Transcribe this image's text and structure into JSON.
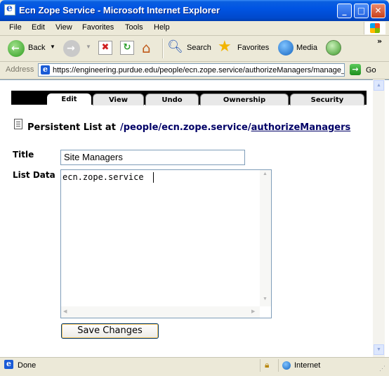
{
  "window": {
    "title": "Ecn Zope Service - Microsoft Internet Explorer"
  },
  "menu": [
    "File",
    "Edit",
    "View",
    "Favorites",
    "Tools",
    "Help"
  ],
  "toolbar": {
    "back": "Back",
    "search": "Search",
    "favorites": "Favorites",
    "media": "Media"
  },
  "address": {
    "label": "Address",
    "url": "https://engineering.purdue.edu/people/ecn.zope.service/authorizeManagers/manage_main",
    "go": "Go"
  },
  "tabs": [
    "Edit",
    "View",
    "Undo",
    "Ownership",
    "Security"
  ],
  "page": {
    "heading": "Persistent List at",
    "path_prefix": "/people/ecn.zope.service/",
    "path_link": "authorizeManagers",
    "title_label": "Title",
    "title_value": "Site Managers",
    "list_label": "List Data",
    "list_value": "ecn.zope.service",
    "save_button": "Save Changes"
  },
  "status": {
    "text": "Done",
    "zone": "Internet"
  },
  "colors": {
    "titlebar": "#0054e3",
    "link": "#000066",
    "tabstrip": "#000000"
  }
}
